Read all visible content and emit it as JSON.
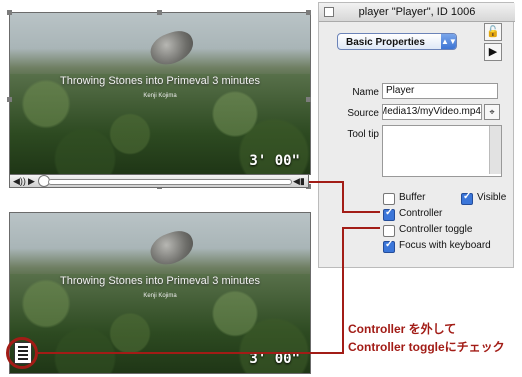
{
  "video": {
    "title": "Throwing Stones into Primeval  3 minutes",
    "subtitle": "Kenji Kojima",
    "time": "3' 00\""
  },
  "panel": {
    "window_title": "player \"Player\", ID 1006",
    "properties_popup": "Basic Properties",
    "name_label": "Name",
    "name_value": "Player",
    "source_label": "Source",
    "source_value": "Media13/myVideo.mp4",
    "tooltip_label": "Tool tip",
    "options": {
      "buffer": "Buffer",
      "visible": "Visible",
      "controller": "Controller",
      "controller_toggle": "Controller toggle",
      "focus": "Focus with keyboard"
    }
  },
  "annotation": {
    "line1": "Controller を外して",
    "line2": "Controller toggleにチェック"
  }
}
